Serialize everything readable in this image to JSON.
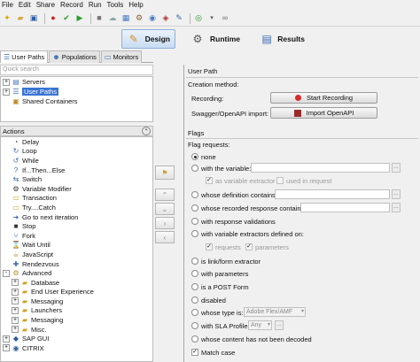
{
  "menu": [
    "File",
    "Edit",
    "Share",
    "Record",
    "Run",
    "Tools",
    "Help"
  ],
  "modes": [
    {
      "label": "Design",
      "icon": "design-icon"
    },
    {
      "label": "Runtime",
      "icon": "runtime-icon"
    },
    {
      "label": "Results",
      "icon": "results-icon"
    }
  ],
  "left_tabs": [
    {
      "label": "User Paths",
      "icon": "user-paths-icon"
    },
    {
      "label": "Populations",
      "icon": "populations-icon"
    },
    {
      "label": "Monitors",
      "icon": "monitors-icon"
    }
  ],
  "quick_search": {
    "placeholder": "Quick search"
  },
  "project_tree": [
    {
      "label": "Servers",
      "icon": "servers-icon",
      "expander": "+"
    },
    {
      "label": "User Paths",
      "icon": "user-paths-icon",
      "expander": "+",
      "selected": true
    },
    {
      "label": "Shared Containers",
      "icon": "shared-containers-icon",
      "expander": ""
    }
  ],
  "actions_header": "Actions",
  "actions": [
    {
      "label": "Delay",
      "icon": "delay-icon",
      "indent": 1
    },
    {
      "label": "Loop",
      "icon": "loop-icon",
      "indent": 1
    },
    {
      "label": "While",
      "icon": "while-icon",
      "indent": 1
    },
    {
      "label": "If...Then...Else",
      "icon": "if-icon",
      "indent": 1
    },
    {
      "label": "Switch",
      "icon": "switch-icon",
      "indent": 1
    },
    {
      "label": "Variable Modifier",
      "icon": "variable-modifier-icon",
      "indent": 1
    },
    {
      "label": "Transaction",
      "icon": "transaction-icon",
      "indent": 1
    },
    {
      "label": "Try....Catch",
      "icon": "try-catch-icon",
      "indent": 1
    },
    {
      "label": "Go to next iteration",
      "icon": "go-next-icon",
      "indent": 1
    },
    {
      "label": "Stop",
      "icon": "stop-icon",
      "indent": 1
    },
    {
      "label": "Fork",
      "icon": "fork-icon",
      "indent": 1
    },
    {
      "label": "Wait Until",
      "icon": "wait-until-icon",
      "indent": 1
    },
    {
      "label": "JavaScript",
      "icon": "javascript-icon",
      "indent": 1
    },
    {
      "label": "Rendezvous",
      "icon": "rendezvous-icon",
      "indent": 1
    },
    {
      "label": "Advanced",
      "icon": "advanced-icon",
      "indent": 0,
      "expander": "-"
    },
    {
      "label": "Database",
      "icon": "database-icon",
      "indent": 2,
      "expander": "+"
    },
    {
      "label": "End User Experience",
      "icon": "end-user-icon",
      "indent": 2,
      "expander": "+"
    },
    {
      "label": "Messaging",
      "icon": "messaging-icon",
      "indent": 2,
      "expander": "+"
    },
    {
      "label": "Launchers",
      "icon": "launchers-icon",
      "indent": 2,
      "expander": "+"
    },
    {
      "label": "Messaging",
      "icon": "messaging-icon",
      "indent": 2,
      "expander": "+"
    },
    {
      "label": "Misc.",
      "icon": "misc-icon",
      "indent": 2,
      "expander": "+"
    },
    {
      "label": "SAP GUI",
      "icon": "sap-gui-icon",
      "indent": 0,
      "expander": "+"
    },
    {
      "label": "CITRIX",
      "icon": "citrix-icon",
      "indent": 0,
      "expander": "+"
    }
  ],
  "user_path": {
    "title": "User Path",
    "creation_method": "Creation method:",
    "recording_label": "Recording:",
    "start_recording": "Start Recording",
    "swagger_label": "Swagger/OpenAPI import:",
    "import_openapi": "Import OpenAPI"
  },
  "flags": {
    "title": "Flags",
    "flag_requests": "Flag requests:",
    "none": "none",
    "with_variable": "with the variable:",
    "as_variable_extractor": "as variable extractor",
    "used_in_request": "used in request",
    "definition_contains": "whose definition contains:",
    "recorded_response_contains": "whose recorded response contains:",
    "with_response_validations": "with response validations",
    "with_variable_extractors": "with variable extractors defined on:",
    "requests": "requests",
    "parameters_cb": "parameters",
    "link_form_extractor": "is link/form extractor",
    "with_parameters": "with parameters",
    "post_form": "is a POST Form",
    "disabled": "disabled",
    "type_is": "whose type is:",
    "type_value": "Adobe Flex/AMF",
    "sla_profile": "with SLA Profile:",
    "sla_value": "Any",
    "not_decoded": "whose content has not been decoded",
    "match_case": "Match case"
  }
}
